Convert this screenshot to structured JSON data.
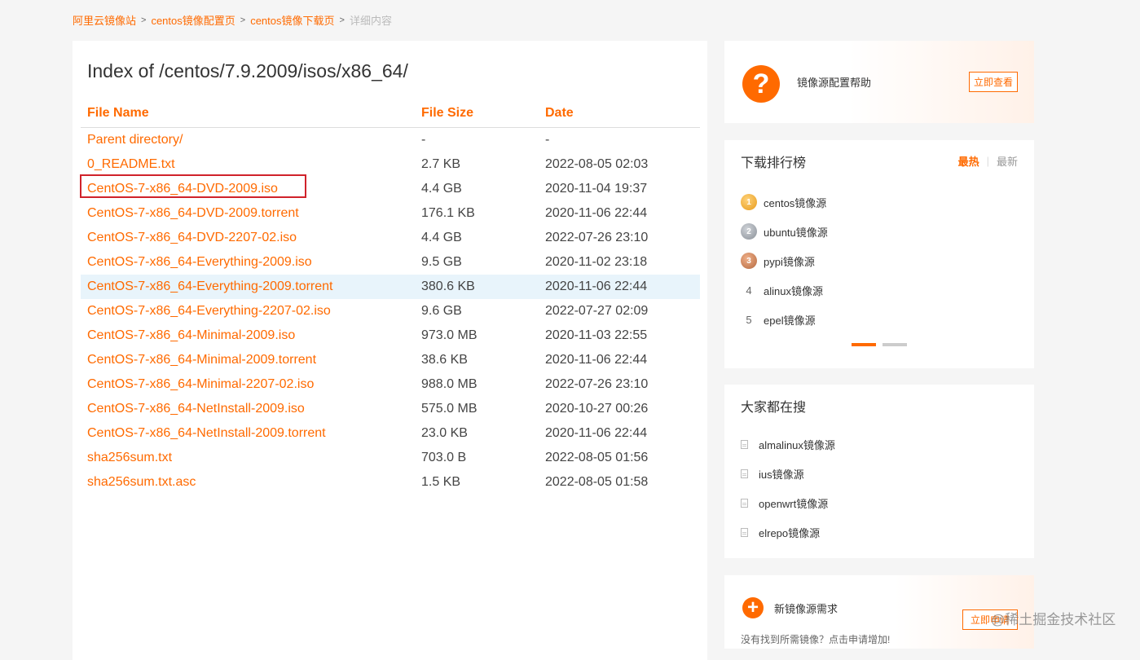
{
  "breadcrumb": {
    "items": [
      "阿里云镜像站",
      "centos镜像配置页",
      "centos镜像下载页"
    ],
    "current": "详细内容",
    "separator": ">"
  },
  "main": {
    "title": "Index of /centos/7.9.2009/isos/x86_64/",
    "columns": [
      "File Name",
      "File Size",
      "Date"
    ],
    "rows": [
      {
        "name": "Parent directory/",
        "size": "-",
        "date": "-"
      },
      {
        "name": "0_README.txt",
        "size": "2.7 KB",
        "date": "2022-08-05 02:03"
      },
      {
        "name": "CentOS-7-x86_64-DVD-2009.iso",
        "size": "4.4 GB",
        "date": "2020-11-04 19:37"
      },
      {
        "name": "CentOS-7-x86_64-DVD-2009.torrent",
        "size": "176.1 KB",
        "date": "2020-11-06 22:44"
      },
      {
        "name": "CentOS-7-x86_64-DVD-2207-02.iso",
        "size": "4.4 GB",
        "date": "2022-07-26 23:10"
      },
      {
        "name": "CentOS-7-x86_64-Everything-2009.iso",
        "size": "9.5 GB",
        "date": "2020-11-02 23:18"
      },
      {
        "name": "CentOS-7-x86_64-Everything-2009.torrent",
        "size": "380.6 KB",
        "date": "2020-11-06 22:44"
      },
      {
        "name": "CentOS-7-x86_64-Everything-2207-02.iso",
        "size": "9.6 GB",
        "date": "2022-07-27 02:09"
      },
      {
        "name": "CentOS-7-x86_64-Minimal-2009.iso",
        "size": "973.0 MB",
        "date": "2020-11-03 22:55"
      },
      {
        "name": "CentOS-7-x86_64-Minimal-2009.torrent",
        "size": "38.6 KB",
        "date": "2020-11-06 22:44"
      },
      {
        "name": "CentOS-7-x86_64-Minimal-2207-02.iso",
        "size": "988.0 MB",
        "date": "2022-07-26 23:10"
      },
      {
        "name": "CentOS-7-x86_64-NetInstall-2009.iso",
        "size": "575.0 MB",
        "date": "2020-10-27 00:26"
      },
      {
        "name": "CentOS-7-x86_64-NetInstall-2009.torrent",
        "size": "23.0 KB",
        "date": "2020-11-06 22:44"
      },
      {
        "name": "sha256sum.txt",
        "size": "703.0 B",
        "date": "2022-08-05 01:56"
      },
      {
        "name": "sha256sum.txt.asc",
        "size": "1.5 KB",
        "date": "2022-08-05 01:58"
      }
    ]
  },
  "sidebar": {
    "help": {
      "icon": "question-icon",
      "label": "镜像源配置帮助",
      "button": "立即查看"
    },
    "ranking": {
      "title": "下载排行榜",
      "tabs": [
        "最热",
        "最新"
      ],
      "medals": [
        "1",
        "2",
        "3"
      ],
      "ranks": [
        "4",
        "5"
      ],
      "items": [
        "centos镜像源",
        "ubuntu镜像源",
        "pypi镜像源",
        "alinux镜像源",
        "epel镜像源"
      ]
    },
    "search": {
      "title": "大家都在搜",
      "items": [
        "almalinux镜像源",
        "ius镜像源",
        "openwrt镜像源",
        "elrepo镜像源"
      ]
    },
    "new_request": {
      "icon": "plus-icon",
      "label": "新镜像源需求",
      "button": "立即申请",
      "subtext": "没有找到所需镜像？点击申请增加!"
    }
  },
  "watermark": "@稀土掘金技术社区",
  "colors": {
    "accent": "#ff6a00",
    "highlight_row": "#e8f4fb",
    "annotation_box": "#d0222b"
  }
}
